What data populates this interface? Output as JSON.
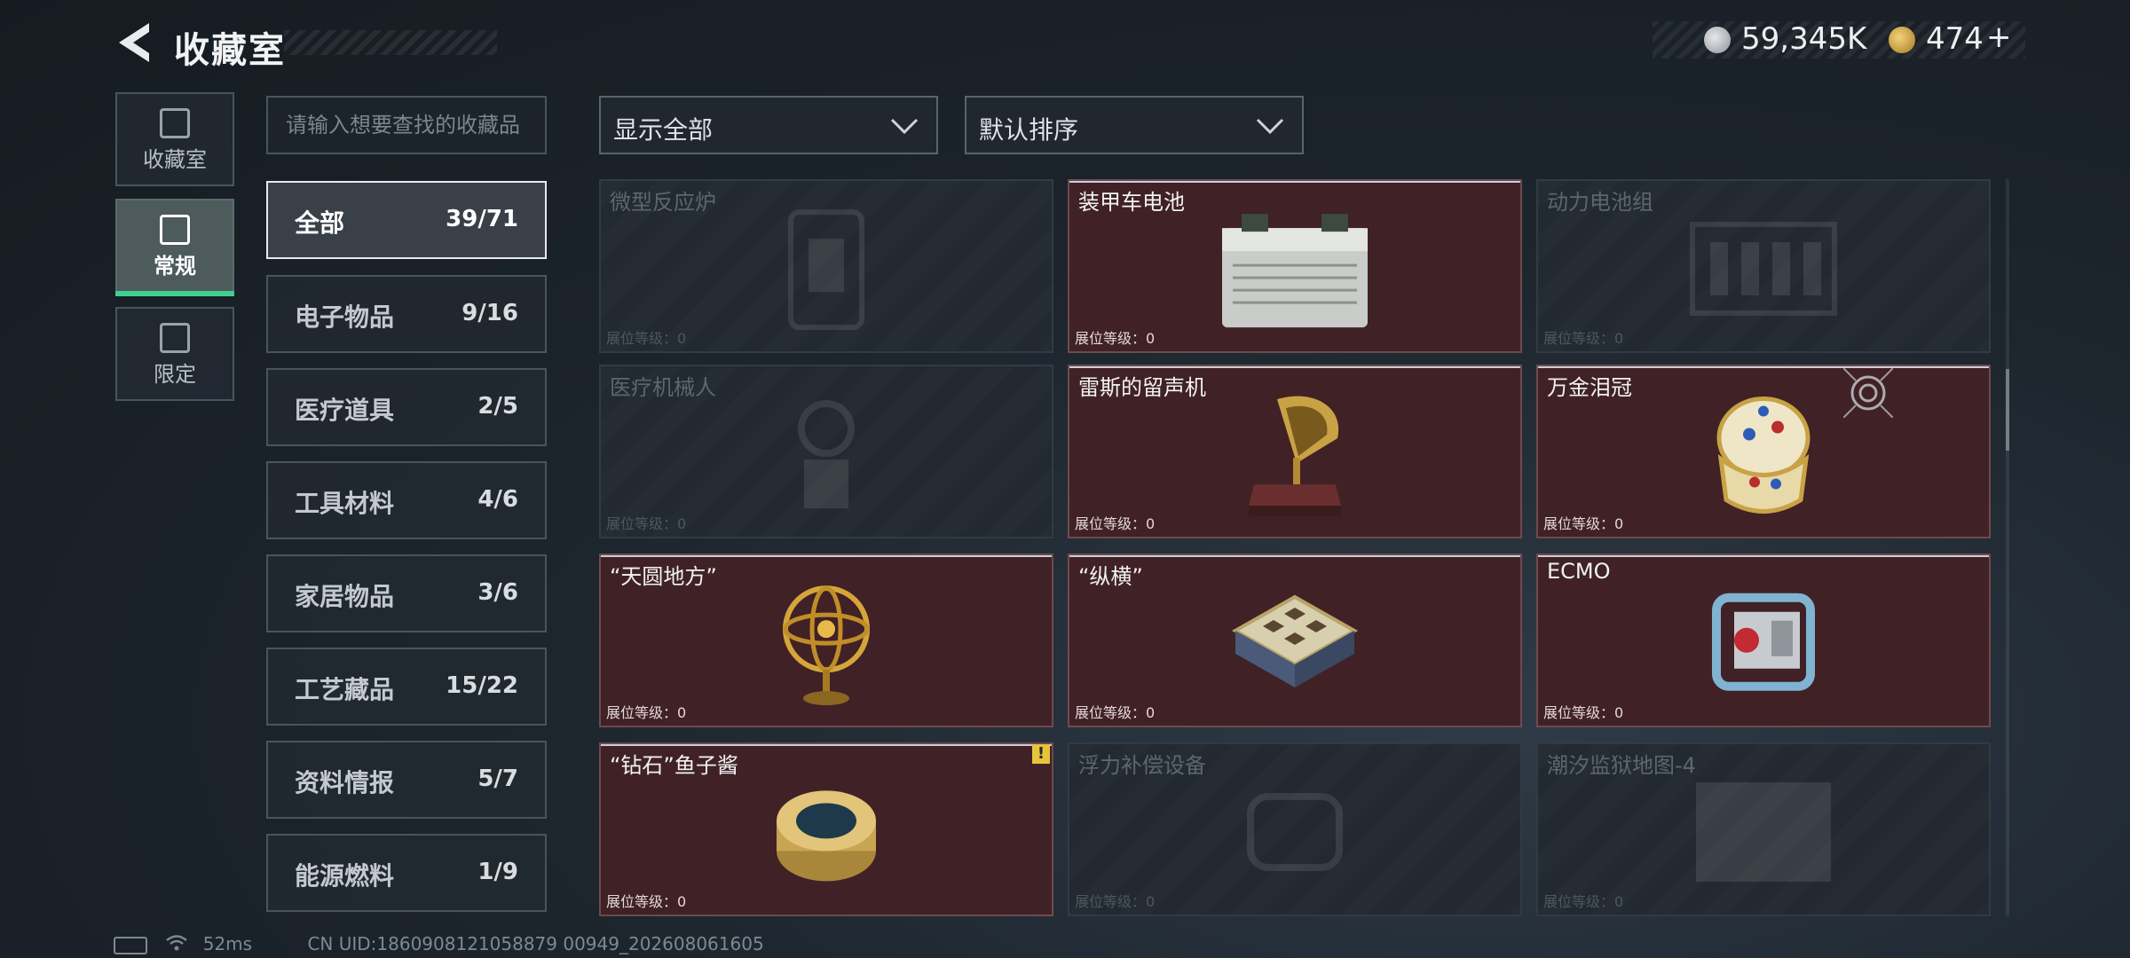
{
  "header": {
    "title": "收藏室"
  },
  "currency": {
    "silver": "59,345K",
    "gold": "474",
    "add_label": "+"
  },
  "rail": [
    {
      "label": "收藏室",
      "icon": "collection-room-icon"
    },
    {
      "label": "常规",
      "icon": "regular-icon",
      "active": true
    },
    {
      "label": "限定",
      "icon": "limited-icon"
    }
  ],
  "search": {
    "placeholder": "请输入想要查找的收藏品",
    "value": ""
  },
  "categories": [
    {
      "name": "全部",
      "count": "39/71",
      "active": true
    },
    {
      "name": "电子物品",
      "count": "9/16"
    },
    {
      "name": "医疗道具",
      "count": "2/5"
    },
    {
      "name": "工具材料",
      "count": "4/6"
    },
    {
      "name": "家居物品",
      "count": "3/6"
    },
    {
      "name": "工艺藏品",
      "count": "15/22"
    },
    {
      "name": "资料情报",
      "count": "5/7"
    },
    {
      "name": "能源燃料",
      "count": "1/9"
    }
  ],
  "filters": {
    "show": "显示全部",
    "sort": "默认排序"
  },
  "level_label": "展位等级：0",
  "items": [
    {
      "name": "微型反应炉",
      "owned": false,
      "icon": "micro-reactor-icon"
    },
    {
      "name": "装甲车电池",
      "owned": true,
      "icon": "armored-battery-icon"
    },
    {
      "name": "动力电池组",
      "owned": false,
      "icon": "power-battery-pack-icon"
    },
    {
      "name": "医疗机械人",
      "owned": false,
      "icon": "medical-robot-icon"
    },
    {
      "name": "雷斯的留声机",
      "owned": true,
      "icon": "gramophone-icon"
    },
    {
      "name": "万金泪冠",
      "owned": true,
      "icon": "jeweled-egg-icon",
      "target": true
    },
    {
      "name": "“天圆地方”",
      "owned": true,
      "icon": "armillary-sphere-icon"
    },
    {
      "name": "“纵横”",
      "owned": true,
      "icon": "chess-board-icon"
    },
    {
      "name": "ECMO",
      "owned": true,
      "icon": "ecmo-machine-icon"
    },
    {
      "name": "“钻石”鱼子酱",
      "owned": true,
      "icon": "caviar-tin-icon",
      "alert": "!"
    },
    {
      "name": "浮力补偿设备",
      "owned": false,
      "icon": "buoyancy-device-icon"
    },
    {
      "name": "潮汐监狱地图-4",
      "owned": false,
      "icon": "prison-map-icon"
    }
  ],
  "footer": {
    "ping": "52ms",
    "uid": "CN UID:1860908121058879 00949_202608061605"
  }
}
